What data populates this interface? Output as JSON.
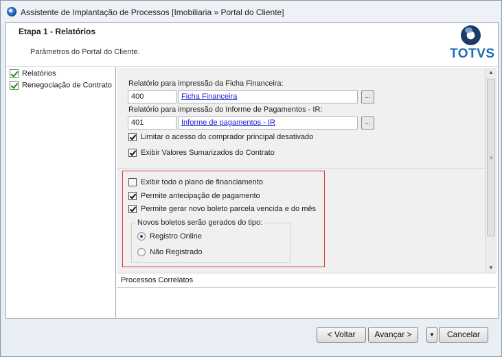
{
  "window": {
    "title": "Assistente de Implantação de Processos [Imobiliaria » Portal do Cliente]"
  },
  "header": {
    "step_title": "Etapa 1 - Relatórios",
    "step_description": "Parâmetros do Portal do Cliente.",
    "logo_text": "TOTVS"
  },
  "tree": {
    "items": [
      {
        "label": "Relatórios",
        "checked": true
      },
      {
        "label": "Renegociação de Contrato",
        "checked": true
      }
    ]
  },
  "form": {
    "ficha_label": "Relatório para impressão da Ficha Financeira:",
    "ficha_code": "400",
    "ficha_name": "Ficha Financeira",
    "informe_label": "Relatório para impressão do Informe de Pagamentos - IR:",
    "informe_code": "401",
    "informe_name": "Informe de pagamentos - IR",
    "lookup_button": "...",
    "checkboxes1": [
      {
        "label": "Limitar o acesso do comprador principal desativado",
        "checked": true
      },
      {
        "label": "Exibir Valores Sumarizados do Contrato",
        "checked": true
      }
    ],
    "checkboxes2": [
      {
        "label": "Exibir todo o plano de financiamento",
        "checked": false
      },
      {
        "label": "Permite antecipação de pagamento",
        "checked": true
      },
      {
        "label": "Permite gerar novo boleto parcela vencida e do mês",
        "checked": true
      }
    ],
    "boletos_group": {
      "legend": "Novos boletos serão gerados do tipo:",
      "options": [
        {
          "label": "Registro Online",
          "selected": true
        },
        {
          "label": "Não Registrado",
          "selected": false
        }
      ]
    }
  },
  "related": {
    "header": "Processos Correlatos"
  },
  "footer": {
    "back": "< Voltar",
    "next": "Avançar >",
    "dropdown": "▼",
    "cancel": "Cancelar"
  },
  "colors": {
    "highlight_frame": "#d23c3c",
    "link": "#1a1ad0",
    "logo_blue": "#1f6bb3"
  }
}
